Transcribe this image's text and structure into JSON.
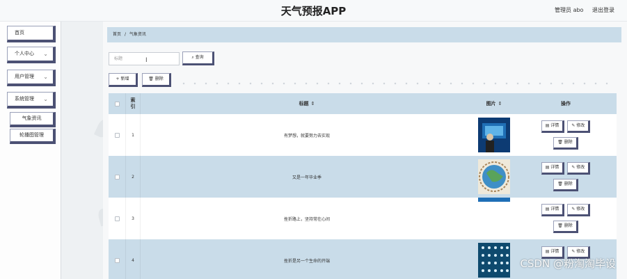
{
  "app": {
    "title": "天气预报APP"
  },
  "topbar": {
    "user_label": "管理员 abo",
    "logout_label": "退出登录"
  },
  "sidebar": {
    "items": [
      {
        "label": "首页"
      },
      {
        "label": "个人中心"
      },
      {
        "label": "用户管理"
      },
      {
        "label": "系统管理"
      }
    ],
    "sub_items": [
      {
        "label": "气象资讯"
      },
      {
        "label": "轮播图管理"
      }
    ]
  },
  "breadcrumb": {
    "home": "首页",
    "separator": "/",
    "current": "气象资讯"
  },
  "search": {
    "placeholder": "标题",
    "button_label": "查询"
  },
  "toolbar": {
    "add_label": "新增",
    "delete_label": "删除"
  },
  "table": {
    "headers": {
      "index": "索引",
      "title": "标题",
      "image": "图片",
      "actions": "操作"
    },
    "rows": [
      {
        "index": "1",
        "title": "有梦想，就要努力去实现"
      },
      {
        "index": "2",
        "title": "又是一年毕业季"
      },
      {
        "index": "3",
        "title": "挫折路上，坚持常在心间"
      },
      {
        "index": "4",
        "title": "挫折是另一个生命的开端"
      }
    ],
    "row_actions": {
      "detail": "详情",
      "edit": "修改",
      "delete": "删除"
    }
  },
  "watermark": "CSDN @粉淘淘毕设",
  "colors": {
    "accent_blue": "#c9dce9",
    "button_border": "#4c5174"
  },
  "icons": {
    "search": "search-icon",
    "add": "plus-icon",
    "delete": "trash-icon",
    "detail": "document-icon",
    "edit": "pencil-icon",
    "expand": "chevron-down-icon",
    "sort": "sort-icon"
  }
}
